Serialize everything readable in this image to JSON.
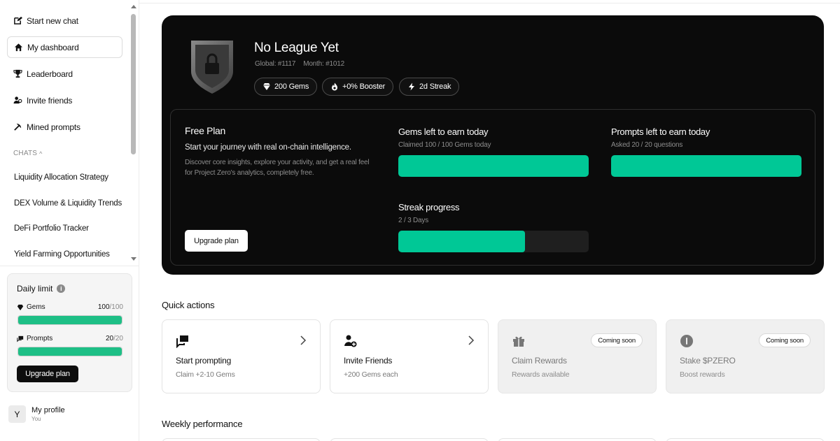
{
  "sidebar": {
    "nav": [
      {
        "label": "Start new chat",
        "icon": "edit-icon"
      },
      {
        "label": "My dashboard",
        "icon": "home-icon",
        "active": true
      },
      {
        "label": "Leaderboard",
        "icon": "trophy-icon"
      },
      {
        "label": "Invite friends",
        "icon": "users-icon"
      },
      {
        "label": "Mined prompts",
        "icon": "pickaxe-icon"
      }
    ],
    "chats_header": "CHATS",
    "chats": [
      "Liquidity Allocation Strategy",
      "DEX Volume & Liquidity Trends",
      "DeFi Portfolio Tracker",
      "Yield Farming Opportunities"
    ],
    "daily_limit": {
      "title": "Daily limit",
      "gems": {
        "label": "Gems",
        "used": "100",
        "max": "/100",
        "fraction": 1.0
      },
      "prompts": {
        "label": "Prompts",
        "used": "20",
        "max": "/20",
        "fraction": 1.0
      },
      "upgrade_label": "Upgrade plan"
    },
    "profile": {
      "initial": "Y",
      "name": "My profile",
      "sub": "You"
    }
  },
  "hero": {
    "league_title": "No League Yet",
    "global_rank": "Global: #1117",
    "month_rank": "Month: #1012",
    "pills": [
      {
        "label": "200 Gems",
        "icon": "gem-icon"
      },
      {
        "label": "+0% Booster",
        "icon": "flame-icon"
      },
      {
        "label": "2d Streak",
        "icon": "bolt-icon"
      }
    ],
    "plan": {
      "title": "Free Plan",
      "subtitle": "Start your journey with real on-chain intelligence.",
      "description": "Discover core insights, explore your activity, and get a real feel for Project Zero's analytics, completely free.",
      "upgrade_label": "Upgrade plan"
    },
    "metrics": {
      "gems": {
        "title": "Gems left to earn today",
        "sub": "Claimed 100 / 100 Gems today",
        "fraction": 1.0
      },
      "prompts": {
        "title": "Prompts left to earn today",
        "sub": "Asked 20 / 20 questions",
        "fraction": 1.0
      },
      "streak": {
        "title": "Streak progress",
        "sub": "2 / 3 Days",
        "fraction": 0.667
      }
    }
  },
  "quick_actions": {
    "title": "Quick actions",
    "cards": [
      {
        "title": "Start prompting",
        "sub": "Claim +2-10 Gems",
        "icon": "chat-icon",
        "enabled": true
      },
      {
        "title": "Invite Friends",
        "sub": "+200 Gems each",
        "icon": "add-user-icon",
        "enabled": true
      },
      {
        "title": "Claim Rewards",
        "sub": "Rewards available",
        "icon": "gift-icon",
        "enabled": false,
        "badge": "Coming soon"
      },
      {
        "title": "Stake $PZERO",
        "sub": "Boost rewards",
        "icon": "coin-icon",
        "enabled": false,
        "badge": "Coming soon"
      }
    ]
  },
  "weekly": {
    "title": "Weekly performance"
  },
  "colors": {
    "accent": "#00c896",
    "dark": "#0b0b0b",
    "limit_fill": "#1ebf86"
  }
}
